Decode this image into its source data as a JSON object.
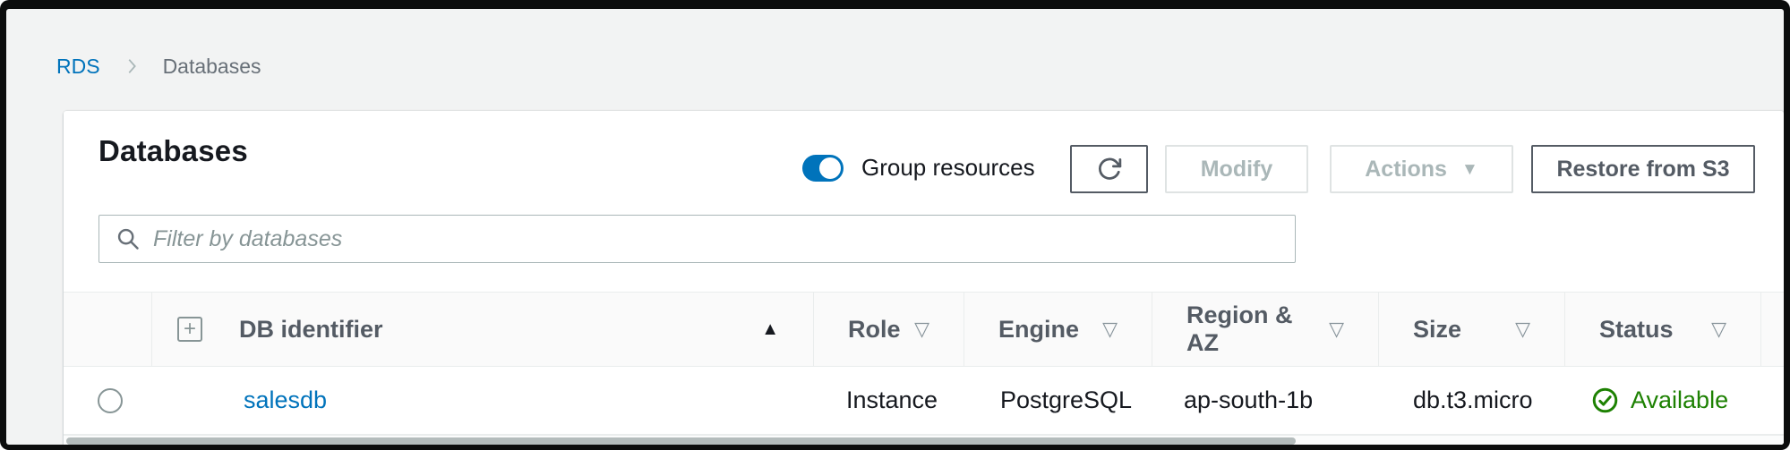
{
  "breadcrumb": {
    "items": [
      {
        "label": "RDS"
      },
      {
        "label": "Databases"
      }
    ]
  },
  "panel": {
    "title": "Databases",
    "group_toggle": {
      "label": "Group resources",
      "state": "on"
    },
    "toolbar": {
      "refresh_icon": "refresh-icon",
      "modify_label": "Modify",
      "actions_label": "Actions",
      "restore_label": "Restore from S3"
    },
    "filter": {
      "placeholder": "Filter by databases",
      "icon": "search-icon"
    }
  },
  "table": {
    "expand_all_icon": "plus-square-icon",
    "columns": [
      {
        "label": "DB identifier",
        "sort": "ascending"
      },
      {
        "label": "Role",
        "filterable": true
      },
      {
        "label": "Engine",
        "filterable": true
      },
      {
        "label": "Region & AZ",
        "filterable": true
      },
      {
        "label": "Size",
        "filterable": true
      },
      {
        "label": "Status",
        "filterable": true
      }
    ],
    "rows": [
      {
        "db_identifier": "salesdb",
        "role": "Instance",
        "engine": "PostgreSQL",
        "region_az": "ap-south-1b",
        "size": "db.t3.micro",
        "status": "Available",
        "status_icon": "check-circle-icon"
      }
    ]
  },
  "icons": {
    "sort_ascending_glyph": "▲",
    "filter_glyph": "▽",
    "caret_down_glyph": "▼",
    "expand_plus_glyph": "+"
  },
  "colors": {
    "link_blue": "#0073bb",
    "toggle_on_blue": "#0073bb",
    "success_green": "#1d8102",
    "header_text": "#545b64",
    "disabled_text": "#aab7b8",
    "text_dark": "#16191f",
    "page_bg": "#f2f3f3",
    "divider": "#eaeded"
  }
}
